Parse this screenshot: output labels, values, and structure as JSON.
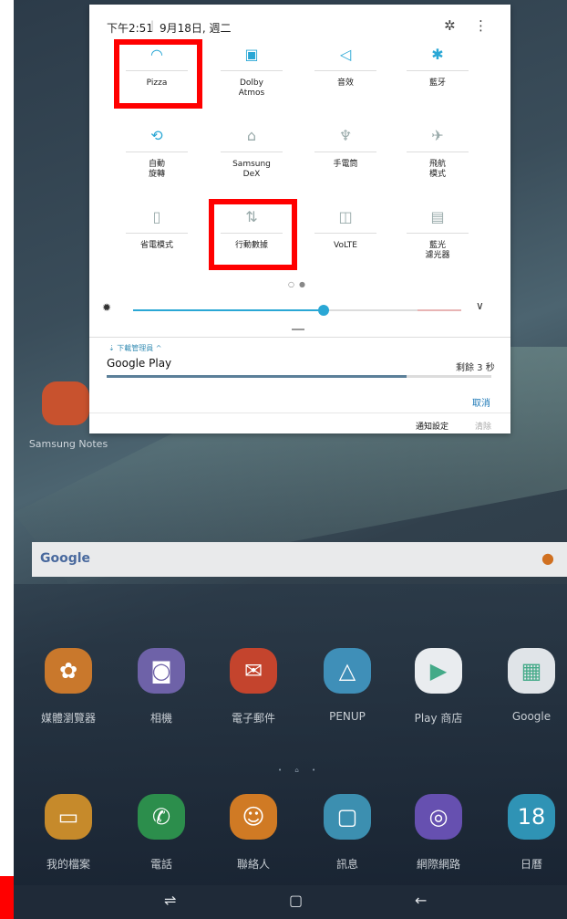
{
  "status": {
    "time": "下午2:51",
    "separator": "|",
    "date": "9月18日, 週二"
  },
  "quick_settings": {
    "row1": [
      {
        "label": "Pizza",
        "icon": "wifi-icon",
        "active": true
      },
      {
        "label": "Dolby\nAtmos",
        "icon": "dolby-icon",
        "active": true
      },
      {
        "label": "音效",
        "icon": "sound-icon",
        "active": true
      },
      {
        "label": "藍牙",
        "icon": "bluetooth-icon",
        "active": true
      }
    ],
    "row2": [
      {
        "label": "自動\n旋轉",
        "icon": "auto-rotate-icon",
        "active": true
      },
      {
        "label": "Samsung\nDeX",
        "icon": "dex-icon",
        "active": false
      },
      {
        "label": "手電筒",
        "icon": "flashlight-icon",
        "active": false
      },
      {
        "label": "飛航\n模式",
        "icon": "airplane-icon",
        "active": false
      }
    ],
    "row3": [
      {
        "label": "省電模式",
        "icon": "power-saving-icon",
        "active": false
      },
      {
        "label": "行動數據",
        "icon": "mobile-data-icon",
        "active": false
      },
      {
        "label": "VoLTE",
        "icon": "volte-icon",
        "active": false
      },
      {
        "label": "藍光\n濾光器",
        "icon": "blue-light-icon",
        "active": false
      }
    ]
  },
  "brightness": {
    "level": 0.58
  },
  "notification": {
    "app": "下載管理員",
    "title": "Google Play",
    "remaining": "剩餘 3 秒",
    "progress": 0.78,
    "cancel": "取消",
    "settings": "通知設定",
    "clear": "清除"
  },
  "home": {
    "samsung_notes": "Samsung Notes",
    "search_logo": "Google",
    "row1": [
      {
        "label": "媒體瀏覽器",
        "color": "#c9782c",
        "icon": "✿"
      },
      {
        "label": "相機",
        "color": "#6e62a8",
        "icon": "◙"
      },
      {
        "label": "電子郵件",
        "color": "#c4442d",
        "icon": "✉"
      },
      {
        "label": "PENUP",
        "color": "#3f8fb8",
        "icon": "△"
      },
      {
        "label": "Play 商店",
        "color": "#e9ecef",
        "icon": "▶"
      },
      {
        "label": "Google",
        "color": "#e0e4e8",
        "icon": "▦"
      }
    ],
    "row2": [
      {
        "label": "我的檔案",
        "color": "#c68a2b",
        "icon": "▭"
      },
      {
        "label": "電話",
        "color": "#2c8e4c",
        "icon": "✆"
      },
      {
        "label": "聯絡人",
        "color": "#d07a24",
        "icon": "☺"
      },
      {
        "label": "訊息",
        "color": "#3c8fb0",
        "icon": "▢"
      },
      {
        "label": "網際網路",
        "color": "#6650b0",
        "icon": "◎"
      },
      {
        "label": "日曆",
        "color": "#2f93b5",
        "icon": "18"
      }
    ]
  },
  "navbar": {
    "recent": "⇌",
    "home": "▢",
    "back": "←"
  },
  "icons": {
    "gear": "✿",
    "more": "⋮",
    "brightness": "☀",
    "expand": "⌄",
    "mic": "🎤"
  }
}
